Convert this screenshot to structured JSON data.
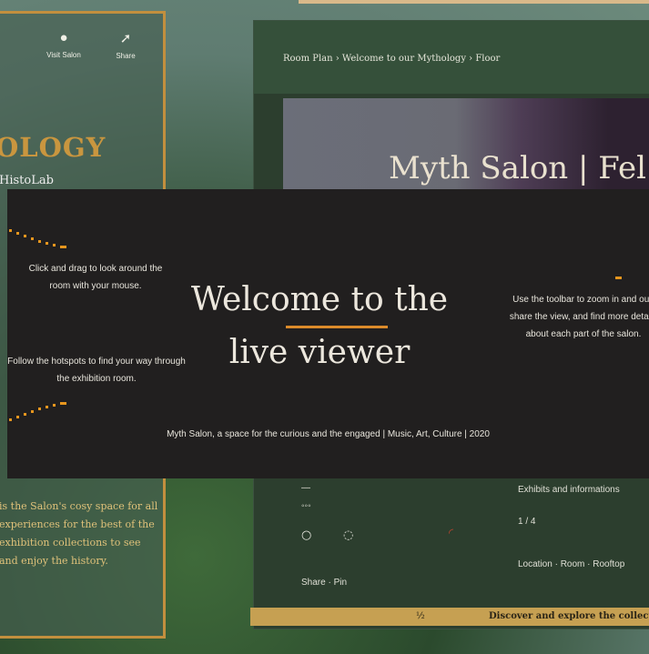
{
  "background_app": {
    "left_panel": {
      "actions": [
        {
          "icon": "info-icon",
          "glyph": "●",
          "label": "Visit Salon"
        },
        {
          "icon": "share-icon",
          "glyph": "➚",
          "label": "Share"
        }
      ],
      "title": "OLOGY",
      "subtitle": "HistoLab",
      "description": "is the Salon's cosy space for all experiences for the best of the exhibition collections to see and enjoy the history."
    },
    "main_window": {
      "breadcrumb": "Room Plan  ›  Welcome to our Mythology  ›  Floor",
      "photo_title": "Myth Salon | Fel",
      "lower_left_lines": [
        "—",
        "◦◦◦"
      ],
      "controls": [
        "○",
        "◌",
        "◜"
      ],
      "rows": [
        "Exhibits and informations",
        "1 / 4",
        "Location · Room · Rooftop",
        "Share · Pin"
      ],
      "bottom_bar": {
        "left": "½",
        "right": "Discover and explore the collection"
      }
    }
  },
  "overlay": {
    "title_line1": "Welcome to the",
    "title_line2": "live viewer",
    "accent_color": "#dc8b2a",
    "left_note_top": "Click and drag to look around the room with your mouse.",
    "left_note_bottom": "Follow the hotspots to find your way through the exhibition room.",
    "right_note": "Use the toolbar to zoom in and out, share the view, and find more details about each part of the salon.",
    "footer": "Myth Salon, a space for the curious and the engaged | Music, Art, Culture | 2020"
  }
}
